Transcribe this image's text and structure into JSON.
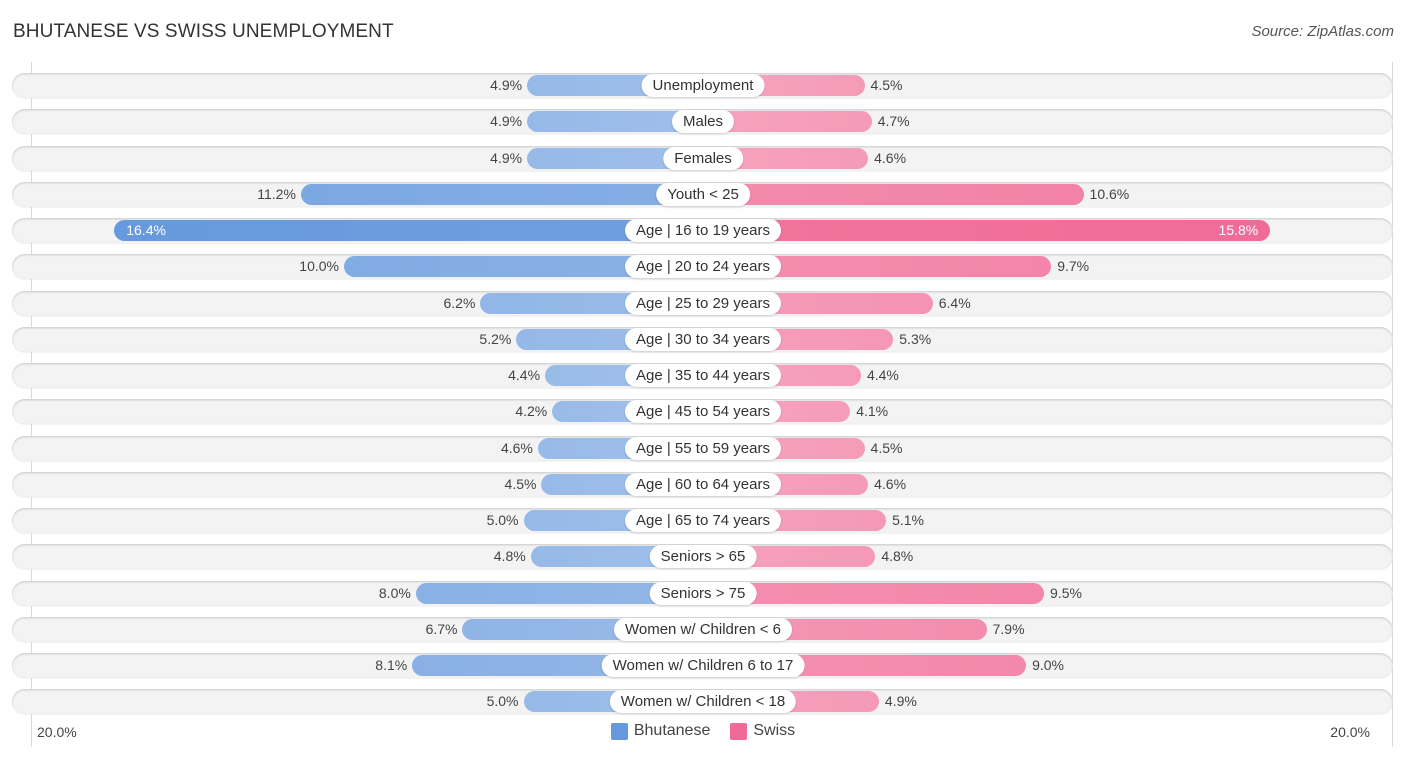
{
  "chart_data": {
    "type": "bar",
    "orientation": "horizontal-diverging",
    "title": "BHUTANESE VS SWISS UNEMPLOYMENT",
    "source": "Source: ZipAtlas.com",
    "categories": [
      "Unemployment",
      "Males",
      "Females",
      "Youth < 25",
      "Age | 16 to 19 years",
      "Age | 20 to 24 years",
      "Age | 25 to 29 years",
      "Age | 30 to 34 years",
      "Age | 35 to 44 years",
      "Age | 45 to 54 years",
      "Age | 55 to 59 years",
      "Age | 60 to 64 years",
      "Age | 65 to 74 years",
      "Seniors > 65",
      "Seniors > 75",
      "Women w/ Children < 6",
      "Women w/ Children 6 to 17",
      "Women w/ Children < 18"
    ],
    "series": [
      {
        "name": "Bhutanese",
        "color": "#6699dd",
        "values": [
          4.9,
          4.9,
          4.9,
          11.2,
          16.4,
          10.0,
          6.2,
          5.2,
          4.4,
          4.2,
          4.6,
          4.5,
          5.0,
          4.8,
          8.0,
          6.7,
          8.1,
          5.0
        ],
        "labels": [
          "4.9%",
          "4.9%",
          "4.9%",
          "11.2%",
          "16.4%",
          "10.0%",
          "6.2%",
          "5.2%",
          "4.4%",
          "4.2%",
          "4.6%",
          "4.5%",
          "5.0%",
          "4.8%",
          "8.0%",
          "6.7%",
          "8.1%",
          "5.0%"
        ]
      },
      {
        "name": "Swiss",
        "color": "#f06a96",
        "values": [
          4.5,
          4.7,
          4.6,
          10.6,
          15.8,
          9.7,
          6.4,
          5.3,
          4.4,
          4.1,
          4.5,
          4.6,
          5.1,
          4.8,
          9.5,
          7.9,
          9.0,
          4.9
        ],
        "labels": [
          "4.5%",
          "4.7%",
          "4.6%",
          "10.6%",
          "15.8%",
          "9.7%",
          "6.4%",
          "5.3%",
          "4.4%",
          "4.1%",
          "4.5%",
          "4.6%",
          "5.1%",
          "4.8%",
          "9.5%",
          "7.9%",
          "9.0%",
          "4.9%"
        ]
      }
    ],
    "xlim": [
      -20,
      20
    ],
    "axis_labels": {
      "left": "20.0%",
      "right": "20.0%"
    },
    "legend": {
      "position": "bottom-center",
      "entries": [
        "Bhutanese",
        "Swiss"
      ]
    },
    "xlabel": "",
    "ylabel": ""
  }
}
